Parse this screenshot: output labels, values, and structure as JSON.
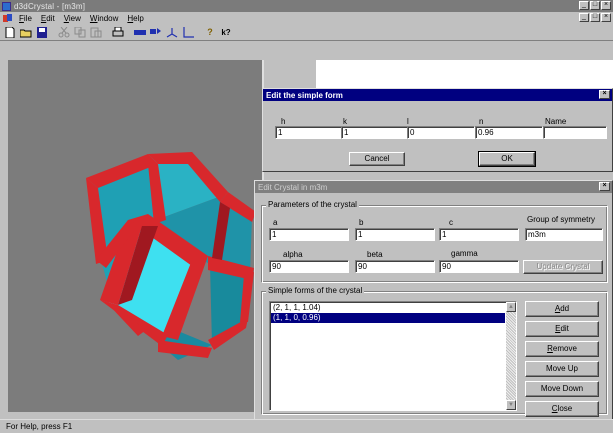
{
  "window": {
    "title": "d3dCrystal - [m3m]",
    "minimize": "_",
    "maximize": "□",
    "close": "×"
  },
  "menu": [
    "File",
    "Edit",
    "View",
    "Window",
    "Help"
  ],
  "toolbar": {
    "help_glyph": "?",
    "context_help_glyph": "k?"
  },
  "status": "For Help, press F1",
  "simple_form_dialog": {
    "title": "Edit the simple form",
    "close": "×",
    "fields": {
      "h": {
        "label": "h",
        "value": "1"
      },
      "k": {
        "label": "k",
        "value": "1"
      },
      "l": {
        "label": "l",
        "value": "0"
      },
      "n": {
        "label": "n",
        "value": "0.96"
      },
      "name": {
        "label": "Name",
        "value": ""
      }
    },
    "cancel": "Cancel",
    "ok": "OK"
  },
  "crystal_dialog": {
    "title": "Edit Crystal in m3m",
    "close": "×",
    "params_group": "Parameters of the crystal",
    "fields": {
      "a": {
        "label": "a",
        "value": "1"
      },
      "b": {
        "label": "b",
        "value": "1"
      },
      "c": {
        "label": "c",
        "value": "1"
      },
      "group": {
        "label": "Group of symmetry",
        "value": "m3m"
      },
      "alpha": {
        "label": "alpha",
        "value": "90"
      },
      "beta": {
        "label": "beta",
        "value": "90"
      },
      "gamma": {
        "label": "gamma",
        "value": "90"
      }
    },
    "update_button": "Update Crystal",
    "forms_group": "Simple forms of the crystal",
    "forms": [
      {
        "text": "(2, 1, 1, 1.04)",
        "selected": false
      },
      {
        "text": "(1, 1, 0, 0.96)",
        "selected": true
      }
    ],
    "buttons": {
      "add": "Add",
      "edit": "Edit",
      "remove": "Remove",
      "move_up": "Move Up",
      "move_down": "Move Down",
      "close": "Close"
    }
  },
  "colors": {
    "face_cyan": "#3cc8d8",
    "face_teal": "#1fa0b4",
    "face_light": "#3ee0f0",
    "edge_red": "#d8282c",
    "edge_dark_red": "#a01820",
    "titlebar_active": "#000080",
    "titlebar_inactive": "#808080",
    "viewport_bg": "#7c7c7c"
  }
}
